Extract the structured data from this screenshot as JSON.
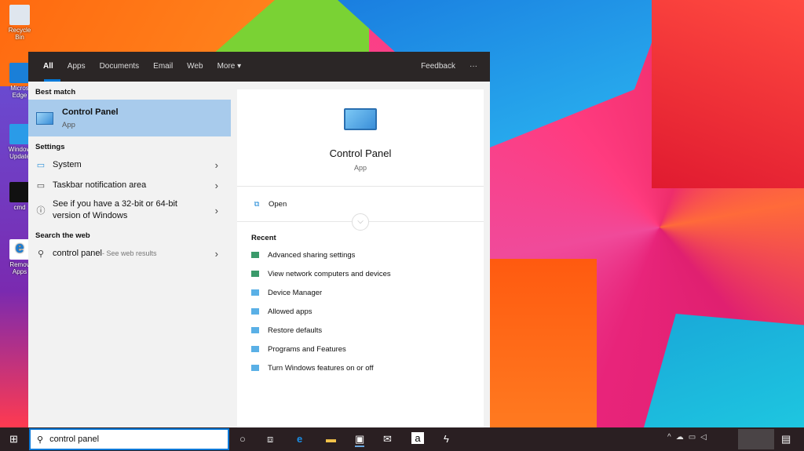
{
  "desktop": {
    "icons": [
      {
        "label": "Recycle Bin"
      },
      {
        "label": "Micros Edge"
      },
      {
        "label": "Window Update"
      },
      {
        "label": "cmd"
      },
      {
        "label": "Remov Apps"
      }
    ]
  },
  "search_menu": {
    "tabs": [
      "All",
      "Apps",
      "Documents",
      "Email",
      "Web",
      "More"
    ],
    "active_tab": "All",
    "feedback": "Feedback",
    "more_options": "···",
    "best_match": {
      "heading": "Best match",
      "name": "Control Panel",
      "type": "App"
    },
    "settings": {
      "heading": "Settings",
      "items": [
        {
          "label": "System",
          "icon": "monitor-icon"
        },
        {
          "label": "Taskbar notification area",
          "icon": "taskbar-icon"
        },
        {
          "label": "See if you have a 32-bit or 64-bit version of Windows",
          "icon": "info-icon"
        }
      ]
    },
    "web": {
      "heading": "Search the web",
      "query": "control panel",
      "hint": " - See web results"
    },
    "preview": {
      "title": "Control Panel",
      "subtitle": "App",
      "open": "Open",
      "recent_heading": "Recent",
      "recent": [
        "Advanced sharing settings",
        "View network computers and devices",
        "Device Manager",
        "Allowed apps",
        "Restore defaults",
        "Programs and Features",
        "Turn Windows features on or off"
      ]
    }
  },
  "taskbar": {
    "search_value": "control panel",
    "accent": "#0078d7"
  }
}
